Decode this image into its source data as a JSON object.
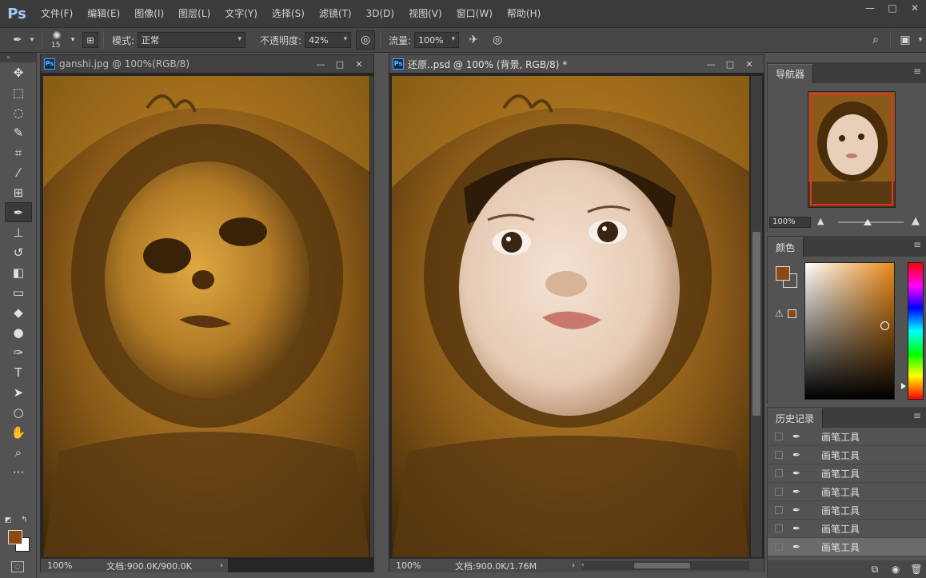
{
  "app": {
    "logo": "Ps",
    "menu": [
      "文件(F)",
      "编辑(E)",
      "图像(I)",
      "图层(L)",
      "文字(Y)",
      "选择(S)",
      "滤镜(T)",
      "3D(D)",
      "视图(V)",
      "窗口(W)",
      "帮助(H)"
    ],
    "window_controls": [
      "—",
      "□",
      "✕"
    ]
  },
  "options": {
    "brush_size": "15",
    "mode_label": "模式:",
    "mode_value": "正常",
    "opacity_label": "不透明度:",
    "opacity_value": "42%",
    "flow_label": "流量:",
    "flow_value": "100%"
  },
  "tools": [
    {
      "name": "move-tool",
      "glyph": "✥"
    },
    {
      "name": "marquee-tool",
      "glyph": "⬚"
    },
    {
      "name": "lasso-tool",
      "glyph": "◌"
    },
    {
      "name": "quick-select-tool",
      "glyph": "✎"
    },
    {
      "name": "crop-tool",
      "glyph": "⌗"
    },
    {
      "name": "eyedropper-tool",
      "glyph": "⁄"
    },
    {
      "name": "healing-tool",
      "glyph": "⊞"
    },
    {
      "name": "brush-tool",
      "glyph": "✒"
    },
    {
      "name": "stamp-tool",
      "glyph": "⊥"
    },
    {
      "name": "history-brush-tool",
      "glyph": "↺"
    },
    {
      "name": "eraser-tool",
      "glyph": "◧"
    },
    {
      "name": "gradient-tool",
      "glyph": "▭"
    },
    {
      "name": "blur-tool",
      "glyph": "◆"
    },
    {
      "name": "dodge-tool",
      "glyph": "●"
    },
    {
      "name": "pen-tool",
      "glyph": "✑"
    },
    {
      "name": "type-tool",
      "glyph": "T"
    },
    {
      "name": "path-select-tool",
      "glyph": "➤"
    },
    {
      "name": "ellipse-tool",
      "glyph": "○"
    },
    {
      "name": "hand-tool",
      "glyph": "✋"
    },
    {
      "name": "zoom-tool",
      "glyph": "⌕"
    },
    {
      "name": "more-tools",
      "glyph": "···"
    }
  ],
  "doc1": {
    "title": "ganshi.jpg @ 100%(RGB/8)",
    "zoom": "100%",
    "doc_info": "文档:900.0K/900.0K"
  },
  "doc2": {
    "title": "还原..psd @ 100% (背景, RGB/8) *",
    "zoom": "100%",
    "doc_info": "文档:900.0K/1.76M"
  },
  "navigator": {
    "tab": "导航器",
    "zoom": "100%"
  },
  "color_panel": {
    "tab": "颜色",
    "foreground": "#8b4a14"
  },
  "history": {
    "tab": "历史记录",
    "items": [
      "画笔工具",
      "画笔工具",
      "画笔工具",
      "画笔工具",
      "画笔工具",
      "画笔工具",
      "画笔工具"
    ]
  },
  "colors": {
    "fur_dark": "#3a2408",
    "fur_mid": "#8a5a18",
    "fur_light": "#c8902e",
    "accent_red": "#e0332b"
  }
}
